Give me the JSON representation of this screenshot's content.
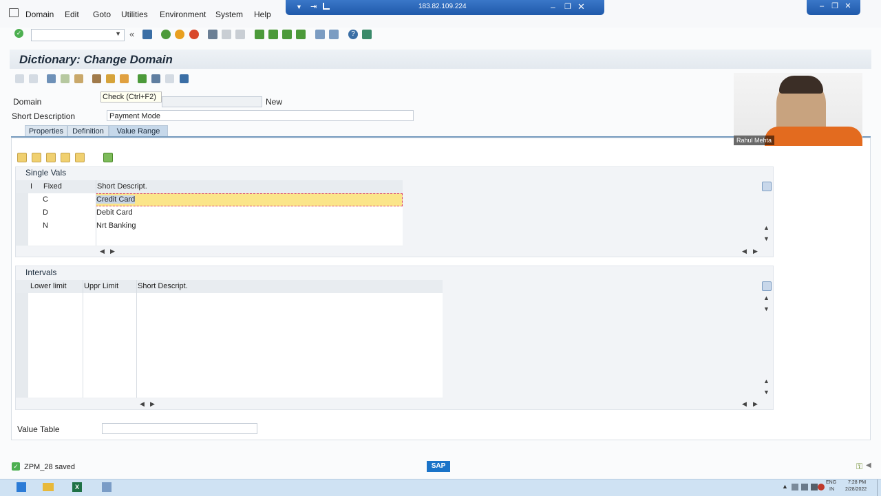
{
  "menu": {
    "items": [
      "Domain",
      "Edit",
      "Goto",
      "Utilities",
      "Environment",
      "System",
      "Help"
    ]
  },
  "remote": {
    "ip": "183.82.109.224"
  },
  "title": "Dictionary: Change Domain",
  "tooltip": "Check   (Ctrl+F2)",
  "form": {
    "domain_label": "Domain",
    "domain_value": "ZPM_28",
    "domain_status": "New",
    "short_desc_label": "Short Description",
    "short_desc_value": "Payment Mode"
  },
  "tabs": [
    "Properties",
    "Definition",
    "Value Range"
  ],
  "single_vals": {
    "title": "Single Vals",
    "headers": {
      "i": "I",
      "fixed": "Fixed",
      "desc": "Short Descript."
    },
    "rows": [
      {
        "fixed": "C",
        "desc": "Credit Card"
      },
      {
        "fixed": "D",
        "desc": "Debit Card"
      },
      {
        "fixed": "N",
        "desc": "Nrt Banking"
      }
    ]
  },
  "intervals": {
    "title": "Intervals",
    "headers": {
      "lower": "Lower limit",
      "upper": "Uppr Limit",
      "desc": "Short Descript."
    }
  },
  "value_table": {
    "label": "Value Table",
    "value": ""
  },
  "status": {
    "message": "ZPM_28 saved"
  },
  "webcam": {
    "name": "Rahul Mehta"
  },
  "tray": {
    "lang1": "ENG",
    "lang2": "IN",
    "time": "7:28 PM",
    "date": "2/28/2022"
  },
  "brand": {
    "logo": "SAP"
  },
  "colors": {
    "accent": "#1f59aa",
    "selection": "#fbe58a",
    "logo": "#1a73c8"
  }
}
